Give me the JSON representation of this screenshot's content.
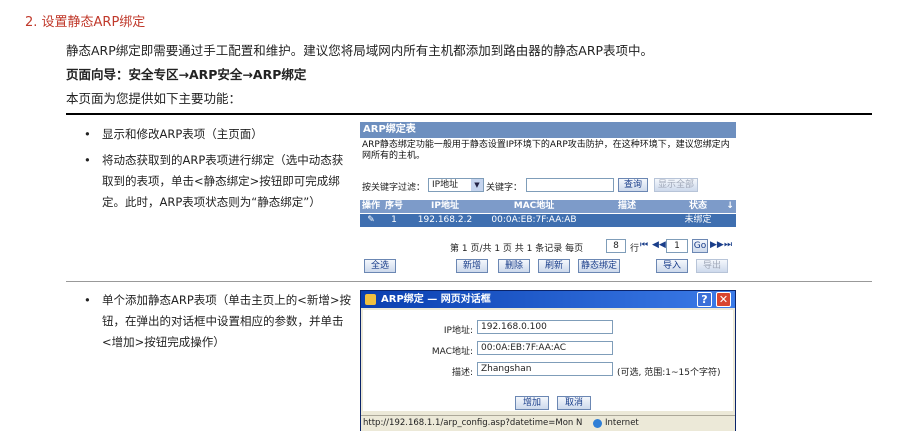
{
  "section_title": "2. 设置静态ARP绑定",
  "intro": "静态ARP绑定即需要通过手工配置和维护。建议您将局域网内所有主机都添加到路由器的静态ARP表项中。",
  "nav_path": "页面向导：安全专区→ARP安全→ARP绑定",
  "features_intro": "本页面为您提供如下主要功能：",
  "bullets": [
    {
      "text": "显示和修改ARP表项（主页面）"
    },
    {
      "text": "将动态获取到的ARP表项进行绑定（选中动态获取到的表项，单击<静态绑定>按钮即可完成绑定。此时，ARP表项状态则为“静态绑定”）"
    },
    {
      "text": "单个添加静态ARP表项（单击主页上的<新增>按钮，在弹出的对话框中设置相应的参数，并单击<增加>按钮完成操作）"
    }
  ],
  "arp_panel": {
    "title": "ARP绑定表",
    "description": "ARP静态绑定功能一般用于静态设置IP环境下的ARP攻击防护，在这种环境下，建议您绑定内网所有的主机。",
    "filter_label": "按关键字过滤：",
    "filter_select": "IP地址",
    "keyword_label": "关键字：",
    "keyword_value": "",
    "query_btn": "查询",
    "show_all_btn": "显示全部",
    "columns": [
      "操作",
      "序号",
      "IP地址",
      "MAC地址",
      "描述",
      "状态"
    ],
    "rows": [
      {
        "index": "1",
        "ip": "192.168.2.2",
        "mac": "00:0A:EB:7F:AA:AB",
        "desc": "",
        "status": "未绑定"
      }
    ],
    "pager_text": "第 1 页/共 1 页 共 1 条记录 每页",
    "per_page": "8",
    "row_label": "行",
    "page_input": "1",
    "go_btn": "Go",
    "buttons": {
      "select_all": "全选",
      "add": "新增",
      "delete": "删除",
      "refresh": "刷新",
      "static_bind": "静态绑定",
      "import": "导入",
      "export": "导出"
    }
  },
  "dialog": {
    "title": "ARP绑定 — 网页对话框",
    "help": "?",
    "close": "✕",
    "ip_label": "IP地址:",
    "ip_value": "192.168.0.100",
    "mac_label": "MAC地址:",
    "mac_value": "00:0A:EB:7F:AA:AC",
    "desc_label": "描述:",
    "desc_value": "Zhangshan",
    "desc_hint": "(可选, 范围:1~15个字符)",
    "add_btn": "增加",
    "cancel_btn": "取消",
    "status_url": "http://192.168.1.1/arp_config.asp?datetime=Mon N",
    "status_zone": "Internet"
  }
}
